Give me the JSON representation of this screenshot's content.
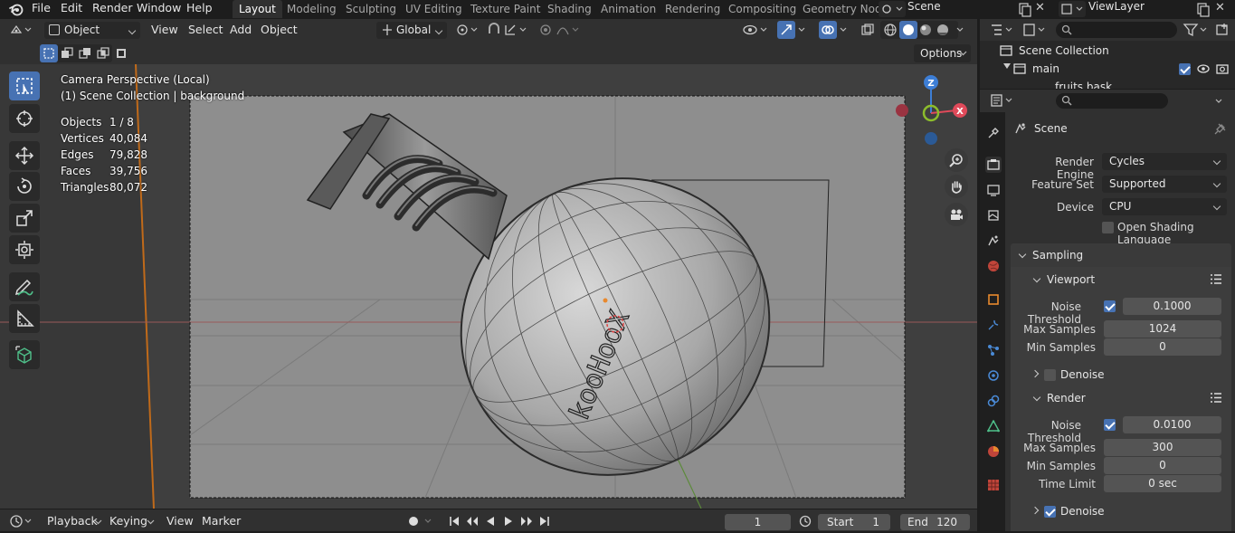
{
  "topbar": {
    "menus": [
      "File",
      "Edit",
      "Render",
      "Window",
      "Help"
    ],
    "workspaces": [
      "Layout",
      "Modeling",
      "Sculpting",
      "UV Editing",
      "Texture Paint",
      "Shading",
      "Animation",
      "Rendering",
      "Compositing",
      "Geometry Nod"
    ],
    "active_workspace": "Layout",
    "scene_name": "Scene",
    "view_layer": "ViewLayer"
  },
  "viewport_header": {
    "mode": "Object Mode",
    "menus": [
      "View",
      "Select",
      "Add",
      "Object"
    ],
    "transform_orientation": "Global",
    "options_label": "Options"
  },
  "viewport": {
    "camera_title": "Camera Perspective (Local)",
    "collection_line": "(1) Scene Collection | background",
    "stats": [
      {
        "label": "Objects",
        "value": "1 / 8"
      },
      {
        "label": "Vertices",
        "value": "40,084"
      },
      {
        "label": "Edges",
        "value": "79,828"
      },
      {
        "label": "Faces",
        "value": "39,756"
      },
      {
        "label": "Triangles",
        "value": "80,072"
      }
    ],
    "bottle_text": "kooHooX",
    "gizmo_axes": {
      "z": "Z",
      "x": "X"
    }
  },
  "outliner": {
    "items": [
      {
        "label": "Scene Collection"
      },
      {
        "label": "main"
      },
      {
        "label": "fruits bask"
      }
    ]
  },
  "properties": {
    "context": "Scene",
    "render_engine": {
      "label": "Render Engine",
      "value": "Cycles"
    },
    "feature_set": {
      "label": "Feature Set",
      "value": "Supported"
    },
    "device": {
      "label": "Device",
      "value": "CPU"
    },
    "osl_label": "Open Shading Language",
    "sampling_label": "Sampling",
    "viewport": {
      "label": "Viewport",
      "noise_threshold_label": "Noise Threshold",
      "noise_threshold": "0.1000",
      "max_samples_label": "Max Samples",
      "max_samples": "1024",
      "min_samples_label": "Min Samples",
      "min_samples": "0",
      "denoise_label": "Denoise"
    },
    "render": {
      "label": "Render",
      "noise_threshold_label": "Noise Threshold",
      "noise_threshold": "0.0100",
      "max_samples_label": "Max Samples",
      "max_samples": "300",
      "min_samples_label": "Min Samples",
      "min_samples": "0",
      "time_limit_label": "Time Limit",
      "time_limit": "0 sec",
      "denoise_label": "Denoise"
    }
  },
  "timeline": {
    "menus": [
      "Playback",
      "Keying",
      "View",
      "Marker"
    ],
    "current_frame": "1",
    "start_label": "Start",
    "start": "1",
    "end_label": "End",
    "end": "120"
  },
  "colors": {
    "accent": "#4772b3",
    "active_tool": "#4772b3",
    "x_axis": "#e04a5a",
    "y_axis": "#8cbd2c",
    "z_axis": "#3d7ed6"
  }
}
